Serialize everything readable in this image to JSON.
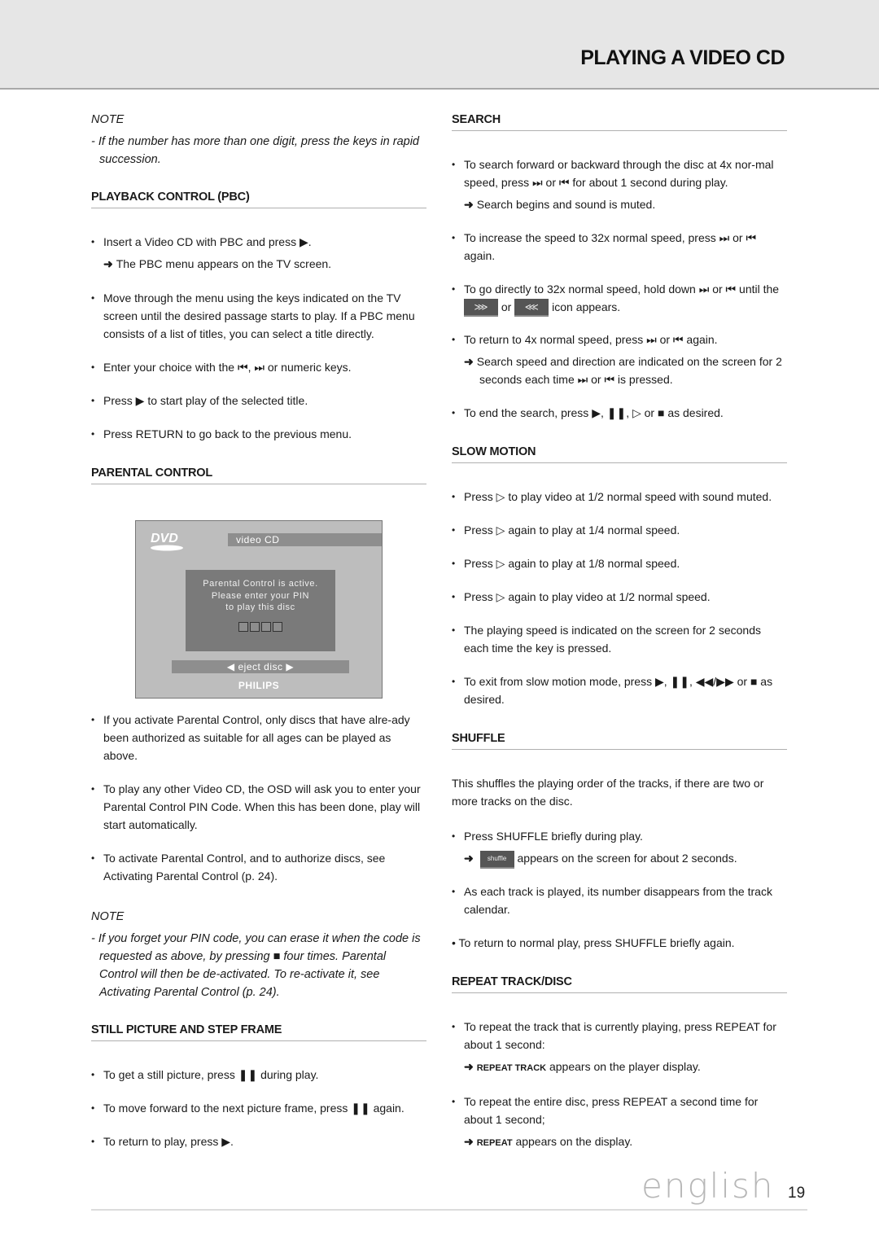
{
  "header": {
    "title": "PLAYING A VIDEO CD"
  },
  "left": {
    "note1": {
      "title": "NOTE",
      "text": "- If the number has more than one digit, press the keys in rapid succession."
    },
    "pbc": {
      "heading": "PLAYBACK CONTROL (PBC)",
      "b1": "Insert a Video CD with PBC and press ▶.",
      "b1_result": "The PBC menu appears on the TV screen.",
      "b2": "Move through the menu using the keys indicated on the TV screen until the desired passage starts to play. If a PBC menu consists of a list of titles, you can select a title directly.",
      "b3": "Enter your choice with the ⏮, ⏭ or numeric keys.",
      "b4": "Press ▶ to start play of the selected title.",
      "b5": "Press RETURN to go back to the previous menu."
    },
    "parental": {
      "heading": "PARENTAL CONTROL",
      "osd": {
        "logo": "DVD",
        "bar": "video CD",
        "line1": "Parental Control is active.",
        "line2": "Please enter your PIN",
        "line3": "to play this disc",
        "eject": "◀ eject disc ▶",
        "brand": "PHILIPS"
      },
      "b1": "If you activate Parental Control, only discs that have alre-ady been authorized as suitable for all ages can be played as above.",
      "b2": "To play any other Video CD, the OSD will ask you to enter your Parental Control PIN Code. When this has been done, play will start automatically.",
      "b3": "To activate Parental Control, and to authorize discs, see Activating Parental Control (p. 24)."
    },
    "note2": {
      "title": "NOTE",
      "text": "- If you forget your PIN code, you can erase it when the code is requested as above, by pressing ■ four times. Parental Control will then be de-activated. To re-activate it, see Activating Parental Control (p. 24)."
    },
    "still": {
      "heading": "STILL PICTURE AND STEP FRAME",
      "b1": "To get a still picture, press ❚❚ during play.",
      "b2": "To move forward to the next picture frame, press ❚❚ again.",
      "b3": "To return to play, press ▶."
    }
  },
  "right": {
    "search": {
      "heading": "SEARCH",
      "b1": "To search forward or backward through the disc at 4x nor-mal speed, press ⏭ or ⏮ for about 1 second during play.",
      "b1_result": "Search begins and sound is muted.",
      "b2": "To increase the speed to 32x normal speed, press ⏭ or ⏮ again.",
      "b3_pre": "To go directly to 32x normal speed, hold down ⏭ or ⏮ until the",
      "b3_icon1": "⋙",
      "b3_or": "or",
      "b3_icon2": "⋘",
      "b3_post": "icon appears.",
      "b4": "To return to 4x normal speed, press ⏭ or ⏮ again.",
      "b4_result": "Search speed and direction are indicated on the screen for 2 seconds each time ⏭ or ⏮ is pressed.",
      "b5": "To end the search, press ▶, ❚❚, ▷ or ■ as desired."
    },
    "slow": {
      "heading": "SLOW MOTION",
      "b1": "Press ▷ to play video at 1/2 normal speed with sound muted.",
      "b2": "Press ▷ again to play at 1/4 normal speed.",
      "b3": "Press ▷ again to play at 1/8 normal speed.",
      "b4": "Press ▷ again to play video at 1/2 normal speed.",
      "b5": "The playing speed is indicated on the screen for 2 seconds each time the key is pressed.",
      "b6": "To exit from slow motion mode, press ▶, ❚❚, ◀◀/▶▶ or ■ as desired."
    },
    "shuffle": {
      "heading": "SHUFFLE",
      "intro": "This shuffles the playing order of the tracks, if there are two or more tracks on the disc.",
      "b1": "Press SHUFFLE briefly during play.",
      "b1_icon": "shuffle",
      "b1_result": "appears on the screen for about 2 seconds.",
      "b2": "As each track is played, its number disappears from the track calendar.",
      "b3": "• To return to normal play, press SHUFFLE briefly again."
    },
    "repeat": {
      "heading": "REPEAT TRACK/DISC",
      "b1": "To repeat the track that is currently playing, press REPEAT for about 1 second:",
      "b1_result_label": "REPEAT TRACK",
      "b1_result": "appears on the player display.",
      "b2": "To repeat the entire disc, press REPEAT a second time for about 1 second;",
      "b2_result_label": "REPEAT",
      "b2_result": "appears on the display."
    }
  },
  "footer": {
    "language": "english",
    "page": "19"
  },
  "arrow": "➜"
}
